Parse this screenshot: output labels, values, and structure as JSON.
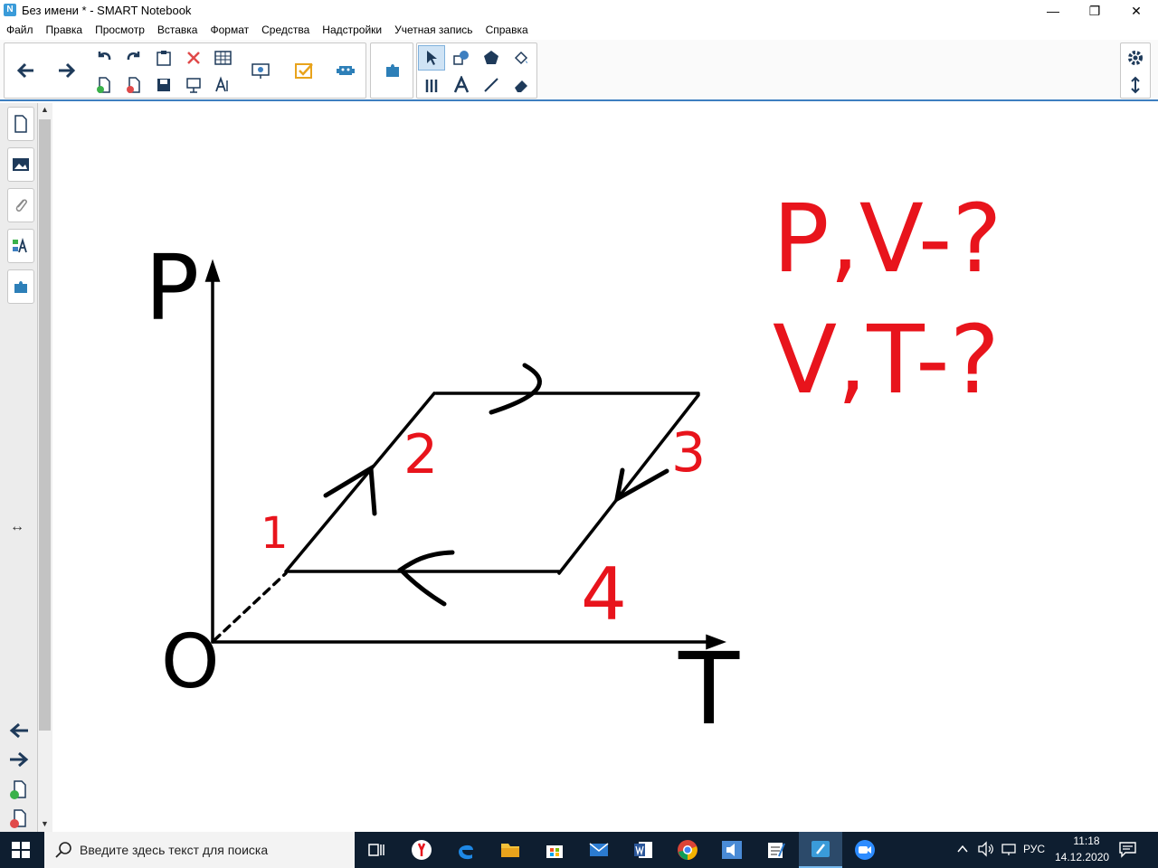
{
  "window": {
    "title": "Без имени * - SMART Notebook",
    "icon_letter": "N",
    "min": "—",
    "restore": "❐",
    "close": "✕"
  },
  "menu": [
    "Файл",
    "Правка",
    "Просмотр",
    "Вставка",
    "Формат",
    "Средства",
    "Надстройки",
    "Учетная запись",
    "Справка"
  ],
  "sidebar": {
    "resize_glyph": "↔"
  },
  "canvas_text": {
    "p_label": "P",
    "t_label": "T",
    "o_label": "O",
    "n1": "1",
    "n2": "2",
    "n3": "3",
    "n4": "4",
    "q1": "P,V-?",
    "q2": "V,T-?"
  },
  "taskbar": {
    "search_placeholder": "Введите здесь текст для поиска",
    "lang": "РУС",
    "time": "11:18",
    "date": "14.12.2020"
  },
  "colors": {
    "accent": "#3d7fc0",
    "handwriting_red": "#e8141c",
    "taskbar": "#0e1e30"
  }
}
